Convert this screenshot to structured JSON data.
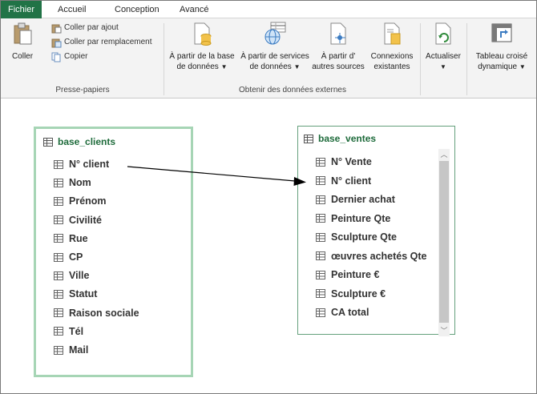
{
  "tabs": [
    {
      "label": "Fichier",
      "active": true
    },
    {
      "label": "Accueil",
      "active": false
    },
    {
      "label": "Conception",
      "active": false
    },
    {
      "label": "Avancé",
      "active": false
    }
  ],
  "ribbon": {
    "clipboard": {
      "paste": "Coller",
      "paste_append": "Coller par ajout",
      "paste_replace": "Coller par remplacement",
      "copy": "Copier",
      "group": "Presse-papiers"
    },
    "external": {
      "from_db_1": "À partir de la base",
      "from_db_2": "de données",
      "from_services_1": "À partir de services",
      "from_services_2": "de données",
      "from_other_1": "À partir d'",
      "from_other_2": "autres sources",
      "existing_1": "Connexions",
      "existing_2": "existantes",
      "group": "Obtenir des données externes"
    },
    "refresh": "Actualiser",
    "pivot_1": "Tableau croisé",
    "pivot_2": "dynamique"
  },
  "tables": {
    "clients": {
      "name": "base_clients",
      "fields": [
        "N° client",
        "Nom",
        "Prénom",
        "Civilité",
        "Rue",
        "CP",
        "Ville",
        "Statut",
        "Raison sociale",
        "Tél",
        "Mail"
      ]
    },
    "ventes": {
      "name": "base_ventes",
      "fields": [
        "N° Vente",
        "N° client",
        "Dernier achat",
        "Peinture Qte",
        "Sculpture Qte",
        "œuvres achetés Qte",
        "Peinture €",
        "Sculpture €",
        "CA total"
      ]
    }
  },
  "colors": {
    "accent": "#217346",
    "table_title": "#1e6b3b",
    "selected_border": "#a6d5b5"
  }
}
